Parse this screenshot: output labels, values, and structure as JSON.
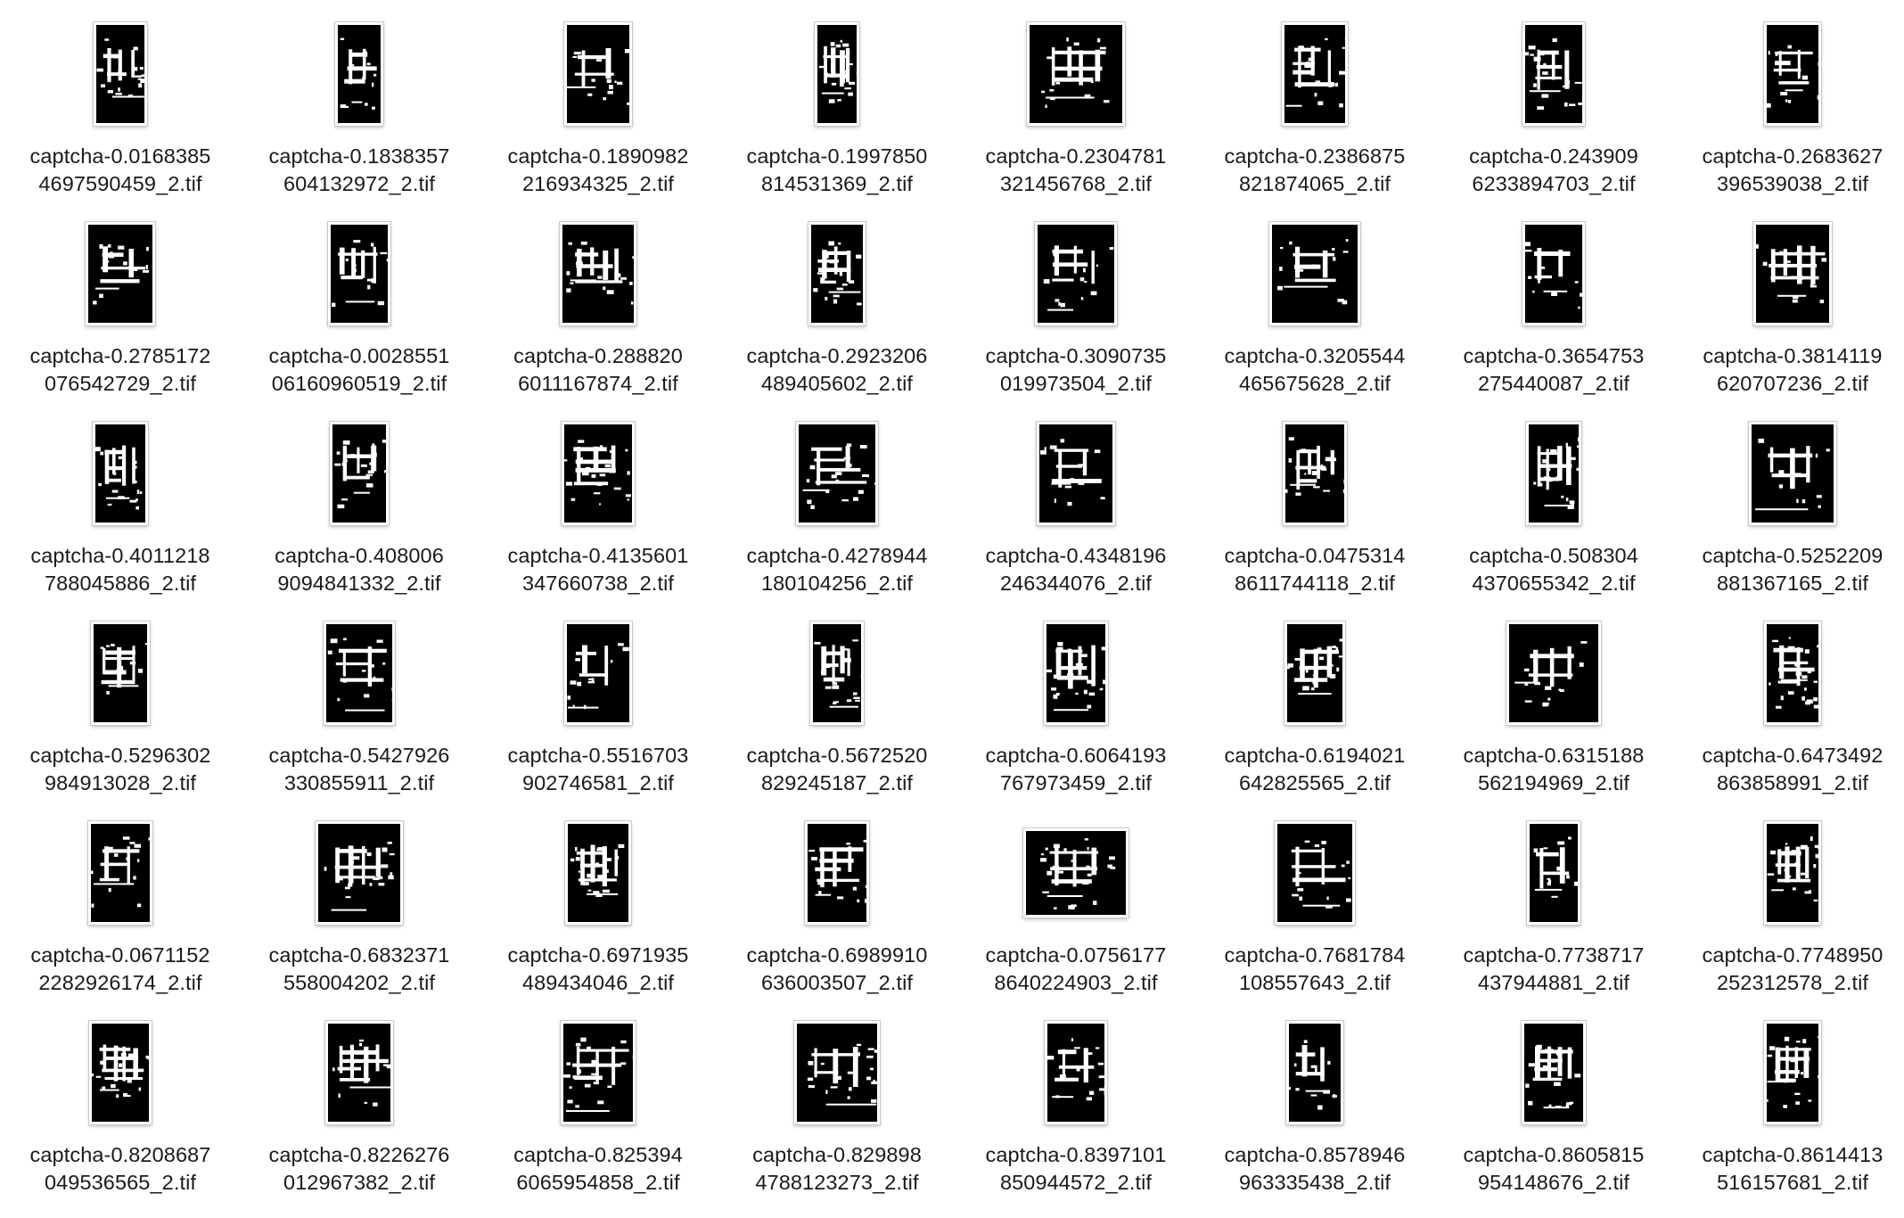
{
  "files": [
    {
      "line1": "captcha-0.0168385",
      "line2": "4697590459_2.tif"
    },
    {
      "line1": "captcha-0.1838357",
      "line2": "604132972_2.tif"
    },
    {
      "line1": "captcha-0.1890982",
      "line2": "216934325_2.tif"
    },
    {
      "line1": "captcha-0.1997850",
      "line2": "814531369_2.tif"
    },
    {
      "line1": "captcha-0.2304781",
      "line2": "321456768_2.tif"
    },
    {
      "line1": "captcha-0.2386875",
      "line2": "821874065_2.tif"
    },
    {
      "line1": "captcha-0.243909",
      "line2": "6233894703_2.tif"
    },
    {
      "line1": "captcha-0.2683627",
      "line2": "396539038_2.tif"
    },
    {
      "line1": "captcha-0.2785172",
      "line2": "076542729_2.tif"
    },
    {
      "line1": "captcha-0.0028551",
      "line2": "06160960519_2.tif"
    },
    {
      "line1": "captcha-0.288820",
      "line2": "6011167874_2.tif"
    },
    {
      "line1": "captcha-0.2923206",
      "line2": "489405602_2.tif"
    },
    {
      "line1": "captcha-0.3090735",
      "line2": "019973504_2.tif"
    },
    {
      "line1": "captcha-0.3205544",
      "line2": "465675628_2.tif"
    },
    {
      "line1": "captcha-0.3654753",
      "line2": "275440087_2.tif"
    },
    {
      "line1": "captcha-0.3814119",
      "line2": "620707236_2.tif"
    },
    {
      "line1": "captcha-0.4011218",
      "line2": "788045886_2.tif"
    },
    {
      "line1": "captcha-0.408006",
      "line2": "9094841332_2.tif"
    },
    {
      "line1": "captcha-0.4135601",
      "line2": "347660738_2.tif"
    },
    {
      "line1": "captcha-0.4278944",
      "line2": "180104256_2.tif"
    },
    {
      "line1": "captcha-0.4348196",
      "line2": "246344076_2.tif"
    },
    {
      "line1": "captcha-0.0475314",
      "line2": "8611744118_2.tif"
    },
    {
      "line1": "captcha-0.508304",
      "line2": "4370655342_2.tif"
    },
    {
      "line1": "captcha-0.5252209",
      "line2": "881367165_2.tif"
    },
    {
      "line1": "captcha-0.5296302",
      "line2": "984913028_2.tif"
    },
    {
      "line1": "captcha-0.5427926",
      "line2": "330855911_2.tif"
    },
    {
      "line1": "captcha-0.5516703",
      "line2": "902746581_2.tif"
    },
    {
      "line1": "captcha-0.5672520",
      "line2": "829245187_2.tif"
    },
    {
      "line1": "captcha-0.6064193",
      "line2": "767973459_2.tif"
    },
    {
      "line1": "captcha-0.6194021",
      "line2": "642825565_2.tif"
    },
    {
      "line1": "captcha-0.6315188",
      "line2": "562194969_2.tif"
    },
    {
      "line1": "captcha-0.6473492",
      "line2": "863858991_2.tif"
    },
    {
      "line1": "captcha-0.0671152",
      "line2": "2282926174_2.tif"
    },
    {
      "line1": "captcha-0.6832371",
      "line2": "558004202_2.tif"
    },
    {
      "line1": "captcha-0.6971935",
      "line2": "489434046_2.tif"
    },
    {
      "line1": "captcha-0.6989910",
      "line2": "636003507_2.tif"
    },
    {
      "line1": "captcha-0.0756177",
      "line2": "8640224903_2.tif"
    },
    {
      "line1": "captcha-0.7681784",
      "line2": "108557643_2.tif"
    },
    {
      "line1": "captcha-0.7738717",
      "line2": "437944881_2.tif"
    },
    {
      "line1": "captcha-0.7748950",
      "line2": "252312578_2.tif"
    },
    {
      "line1": "captcha-0.8208687",
      "line2": "049536565_2.tif"
    },
    {
      "line1": "captcha-0.8226276",
      "line2": "012967382_2.tif"
    },
    {
      "line1": "captcha-0.825394",
      "line2": "6065954858_2.tif"
    },
    {
      "line1": "captcha-0.829898",
      "line2": "4788123273_2.tif"
    },
    {
      "line1": "captcha-0.8397101",
      "line2": "850944572_2.tif"
    },
    {
      "line1": "captcha-0.8578946",
      "line2": "963335438_2.tif"
    },
    {
      "line1": "captcha-0.8605815",
      "line2": "954148676_2.tif"
    },
    {
      "line1": "captcha-0.8614413",
      "line2": "516157681_2.tif"
    }
  ]
}
